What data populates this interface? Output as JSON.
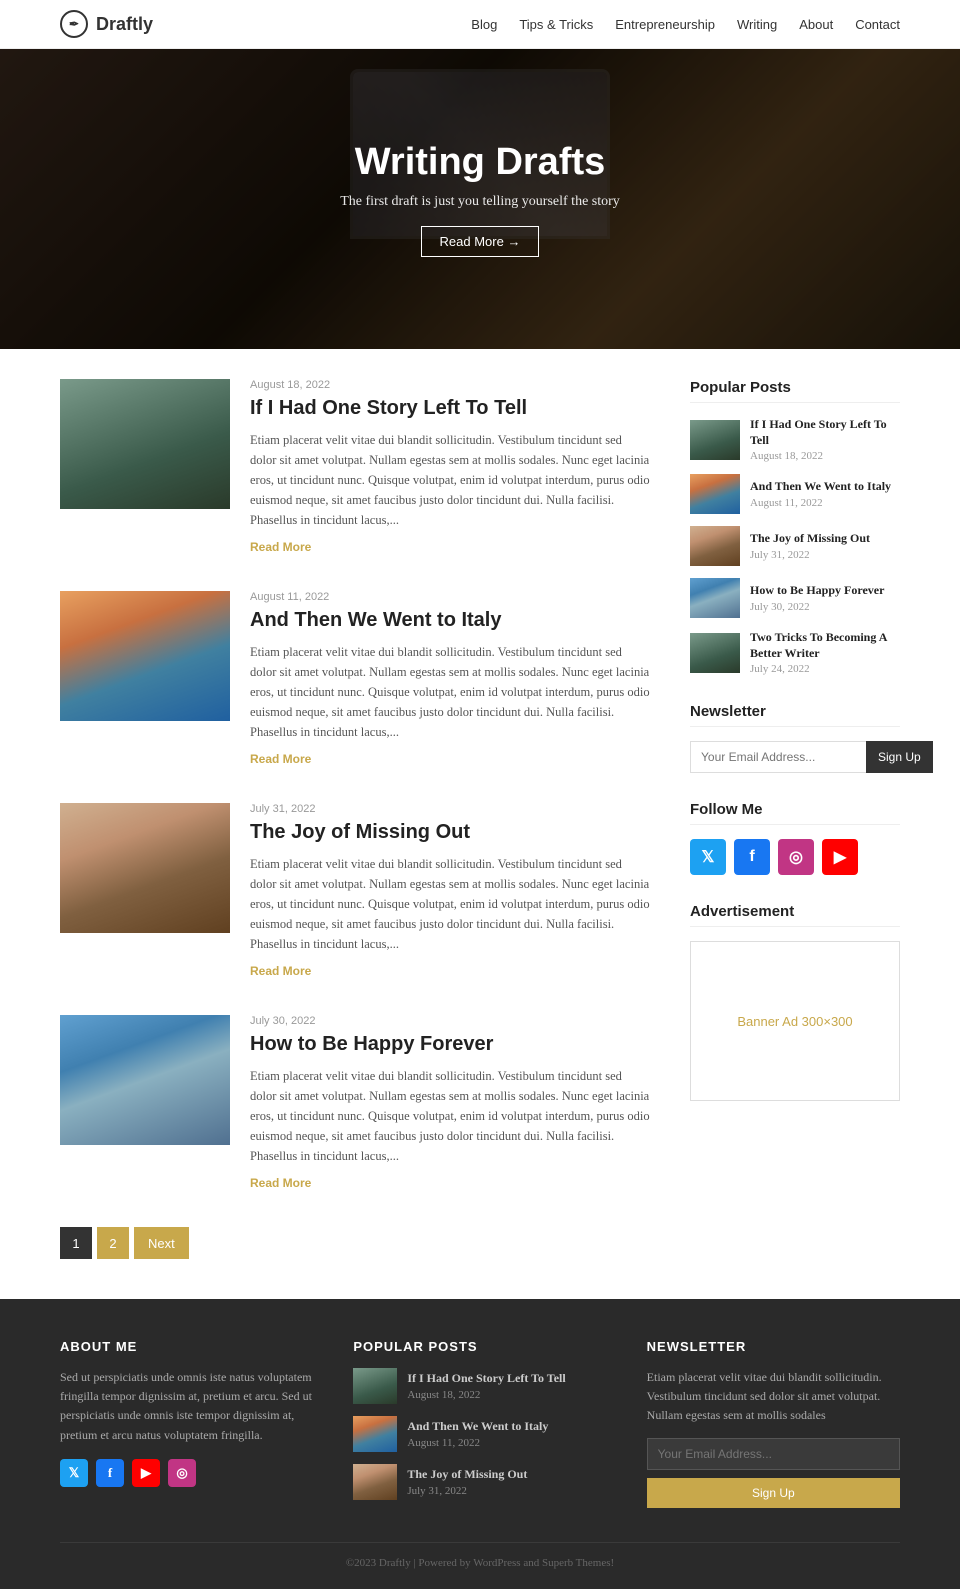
{
  "site": {
    "name": "Draftly",
    "tagline": "Writing Drafts"
  },
  "nav": {
    "logo": "Draftly",
    "links": [
      "Blog",
      "Tips & Tricks",
      "Entrepreneurship",
      "Writing",
      "About",
      "Contact"
    ]
  },
  "hero": {
    "title": "Writing Drafts",
    "subtitle": "The first draft is just you telling yourself the story",
    "btn_label": "Read More →"
  },
  "posts": [
    {
      "date": "August 18, 2022",
      "title": "If I Had One Story Left To Tell",
      "excerpt": "Etiam placerat velit vitae dui blandit sollicitudin. Vestibulum tincidunt sed dolor sit amet volutpat. Nullam egestas sem at mollis sodales. Nunc eget lacinia eros, ut tincidunt nunc. Quisque volutpat, enim id volutpat interdum, purus odio euismod neque, sit amet faucibus justo dolor tincidunt dui. Nulla facilisi. Phasellus in tincidunt lacus,...",
      "read_more": "Read More",
      "img_class": "img-railroad"
    },
    {
      "date": "August 11, 2022",
      "title": "And Then We Went to Italy",
      "excerpt": "Etiam placerat velit vitae dui blandit sollicitudin. Vestibulum tincidunt sed dolor sit amet volutpat. Nullam egestas sem at mollis sodales. Nunc eget lacinia eros, ut tincidunt nunc. Quisque volutpat, enim id volutpat interdum, purus odio euismod neque, sit amet faucibus justo dolor tincidunt dui. Nulla facilisi. Phasellus in tincidunt lacus,...",
      "read_more": "Read More",
      "img_class": "img-italy"
    },
    {
      "date": "July 31, 2022",
      "title": "The Joy of Missing Out",
      "excerpt": "Etiam placerat velit vitae dui blandit sollicitudin. Vestibulum tincidunt sed dolor sit amet volutpat. Nullam egestas sem at mollis sodales. Nunc eget lacinia eros, ut tincidunt nunc. Quisque volutpat, enim id volutpat interdum, purus odio euismod neque, sit amet faucibus justo dolor tincidunt dui. Nulla facilisi. Phasellus in tincidunt lacus,...",
      "read_more": "Read More",
      "img_class": "img-woman"
    },
    {
      "date": "July 30, 2022",
      "title": "How to Be Happy Forever",
      "excerpt": "Etiam placerat velit vitae dui blandit sollicitudin. Vestibulum tincidunt sed dolor sit amet volutpat. Nullam egestas sem at mollis sodales. Nunc eget lacinia eros, ut tincidunt nunc. Quisque volutpat, enim id volutpat interdum, purus odio euismod neque, sit amet faucibus justo dolor tincidunt dui. Nulla facilisi. Phasellus in tincidunt lacus,...",
      "read_more": "Read More",
      "img_class": "img-coast"
    }
  ],
  "pagination": {
    "current": "1",
    "page2": "2",
    "next_label": "Next"
  },
  "sidebar": {
    "popular_title": "Popular Posts",
    "popular_posts": [
      {
        "title": "If I Had One Story Left To Tell",
        "date": "August 18, 2022",
        "img_class": "img-railroad"
      },
      {
        "title": "And Then We Went to Italy",
        "date": "August 11, 2022",
        "img_class": "img-italy"
      },
      {
        "title": "The Joy of Missing Out",
        "date": "July 31, 2022",
        "img_class": "img-woman"
      },
      {
        "title": "How to Be Happy Forever",
        "date": "July 30, 2022",
        "img_class": "img-coast"
      },
      {
        "title": "Two Tricks To Becoming A Better Writer",
        "date": "July 24, 2022",
        "img_class": "img-railroad"
      }
    ],
    "newsletter_title": "Newsletter",
    "newsletter_placeholder": "Your Email Address...",
    "newsletter_btn": "Sign Up",
    "follow_title": "Follow Me",
    "ad_title": "Advertisement",
    "ad_label": "Banner Ad 300×300"
  },
  "footer": {
    "about_title": "ABOUT ME",
    "about_text": "Sed ut perspiciatis unde omnis iste natus voluptatem fringilla tempor dignissim at, pretium et arcu. Sed ut perspiciatis unde omnis iste tempor dignissim at, pretium et arcu natus voluptatem fringilla.",
    "popular_title": "POPULAR POSTS",
    "popular_posts": [
      {
        "title": "If I Had One Story Left To Tell",
        "date": "August 18, 2022",
        "img_class": "img-railroad"
      },
      {
        "title": "And Then We Went to Italy",
        "date": "August 11, 2022",
        "img_class": "img-italy"
      },
      {
        "title": "The Joy of Missing Out",
        "date": "July 31, 2022",
        "img_class": "img-woman"
      }
    ],
    "newsletter_title": "NEWSLETTER",
    "newsletter_text": "Etiam placerat velit vitae dui blandit sollicitudin. Vestibulum tincidunt sed dolor sit amet volutpat. Nullam egestas sem at mollis sodales",
    "newsletter_placeholder": "Your Email Address...",
    "newsletter_btn": "Sign Up",
    "copyright": "©2023 Draftly | Powered by WordPress and Superb Themes!"
  }
}
